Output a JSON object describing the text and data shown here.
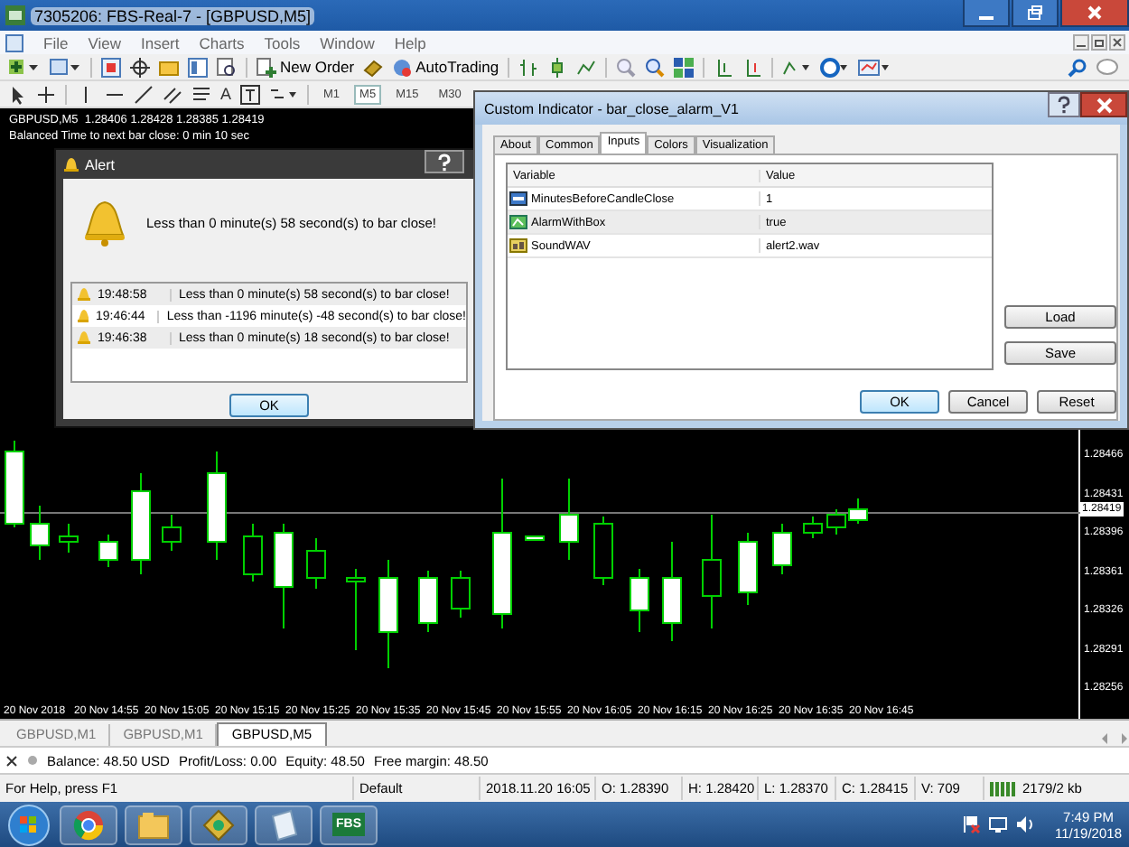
{
  "window": {
    "title": "7305206: FBS-Real-7 - [GBPUSD,M5]"
  },
  "menu": [
    "File",
    "View",
    "Insert",
    "Charts",
    "Tools",
    "Window",
    "Help"
  ],
  "toolbar": {
    "new_order": "New Order",
    "autotrading": "AutoTrading",
    "text_tool": "A",
    "timeframes": [
      {
        "label": "M1",
        "selected": false
      },
      {
        "label": "M5",
        "selected": true
      },
      {
        "label": "M15",
        "selected": false
      },
      {
        "label": "M30",
        "selected": false
      }
    ]
  },
  "chart": {
    "header": "GBPUSD,M5  1.28406 1.28428 1.28385 1.28419",
    "comment": "Balanced Time to next bar close: 0 min 10 sec",
    "price_labels": [
      "1.28466",
      "1.28431",
      "1.28396",
      "1.28361",
      "1.28326",
      "1.28291",
      "1.28256"
    ],
    "current_price": "1.28419",
    "time_labels": [
      "20 Nov 2018",
      "20 Nov 14:55",
      "20 Nov 15:05",
      "20 Nov 15:15",
      "20 Nov 15:25",
      "20 Nov 15:35",
      "20 Nov 15:45",
      "20 Nov 15:55",
      "20 Nov 16:05",
      "20 Nov 16:15",
      "20 Nov 16:25",
      "20 Nov 16:35",
      "20 Nov 16:45"
    ]
  },
  "alert": {
    "title": "Alert",
    "message": "Less than 0 minute(s) 58 second(s) to bar close!",
    "log": [
      {
        "time": "19:48:58",
        "message": "Less than 0 minute(s) 58 second(s) to bar close!"
      },
      {
        "time": "19:46:44",
        "message": "Less than -1196 minute(s) -48 second(s) to bar close!"
      },
      {
        "time": "19:46:38",
        "message": "Less than 0 minute(s) 18 second(s) to bar close!"
      }
    ],
    "ok": "OK"
  },
  "indicator_dialog": {
    "title": "Custom Indicator - bar_close_alarm_V1",
    "tabs": [
      {
        "label": "About",
        "selected": false
      },
      {
        "label": "Common",
        "selected": false
      },
      {
        "label": "Inputs",
        "selected": true
      },
      {
        "label": "Colors",
        "selected": false
      },
      {
        "label": "Visualization",
        "selected": false
      }
    ],
    "columns": [
      "Variable",
      "Value"
    ],
    "inputs": [
      {
        "kind": "number",
        "name": "MinutesBeforeCandleClose",
        "value": "1"
      },
      {
        "kind": "bool",
        "name": "AlarmWithBox",
        "value": "true"
      },
      {
        "kind": "text",
        "name": "SoundWAV",
        "value": "alert2.wav"
      }
    ],
    "side_buttons": [
      "Load",
      "Save"
    ],
    "buttons": [
      "OK",
      "Cancel",
      "Reset"
    ]
  },
  "chart_tabs": [
    {
      "label": "GBPUSD,M1",
      "selected": false
    },
    {
      "label": "GBPUSD,M1",
      "selected": false
    },
    {
      "label": "GBPUSD,M5",
      "selected": true
    }
  ],
  "terminal": {
    "balance": "Balance: 48.50 USD",
    "profit": "Profit/Loss: 0.00",
    "equity": "Equity: 48.50",
    "free_margin": "Free margin: 48.50"
  },
  "status_bar": [
    "For Help, press F1",
    "Default",
    "2018.11.20 16:05",
    "O: 1.28390",
    "H: 1.28420",
    "L: 1.28370",
    "C: 1.28415",
    "V: 709"
  ],
  "traffic": "2179/2 kb",
  "taskbar": {
    "apps": [
      {
        "kind": "browser"
      },
      {
        "kind": "folder"
      },
      {
        "kind": "trading"
      },
      {
        "kind": "notepad"
      },
      {
        "kind": "label",
        "label": "FBS"
      }
    ],
    "time": "7:49 PM",
    "date": "11/19/2018"
  }
}
